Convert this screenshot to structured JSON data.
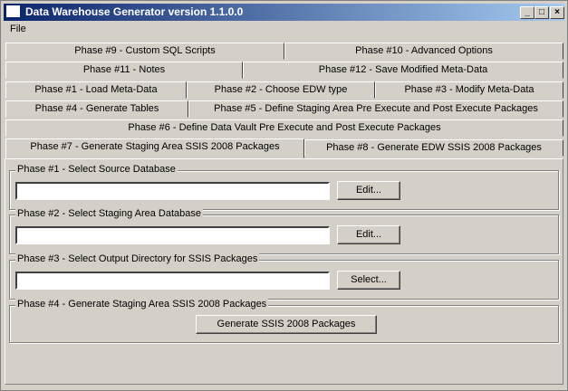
{
  "window": {
    "title": "Data Warehouse Generator version 1.1.0.0",
    "controls": {
      "minimize": "_",
      "maximize": "□",
      "close": "×"
    }
  },
  "menu": {
    "file": "File"
  },
  "tabs": {
    "phase9": "Phase #9 - Custom SQL Scripts",
    "phase10": "Phase #10 - Advanced Options",
    "phase11": "Phase #11 - Notes",
    "phase12": "Phase #12 - Save Modified Meta-Data",
    "phase1": "Phase #1 - Load Meta-Data",
    "phase2": "Phase #2 - Choose EDW type",
    "phase3": "Phase #3 - Modify Meta-Data",
    "phase4": "Phase #4 - Generate Tables",
    "phase5": "Phase #5 - Define Staging Area Pre Execute and Post Execute Packages",
    "phase6": "Phase #6 - Define Data Vault Pre Execute and Post Execute Packages",
    "phase7": "Phase #7 - Generate Staging Area SSIS 2008 Packages",
    "phase8": "Phase #8 - Generate EDW SSIS 2008 Packages",
    "active": "phase7"
  },
  "groups": {
    "source": {
      "label": "Phase #1 - Select Source Database",
      "value": "",
      "button": "Edit..."
    },
    "staging": {
      "label": "Phase #2 - Select Staging Area Database",
      "value": "",
      "button": "Edit..."
    },
    "output": {
      "label": "Phase #3 - Select Output Directory for SSIS Packages",
      "value": "",
      "button": "Select..."
    },
    "generate": {
      "label": "Phase #4 - Generate Staging Area SSIS 2008 Packages",
      "button": "Generate SSIS 2008 Packages"
    }
  },
  "colors": {
    "face": "#d4d0c8",
    "title_start": "#0a246a",
    "title_end": "#a6caf0"
  }
}
